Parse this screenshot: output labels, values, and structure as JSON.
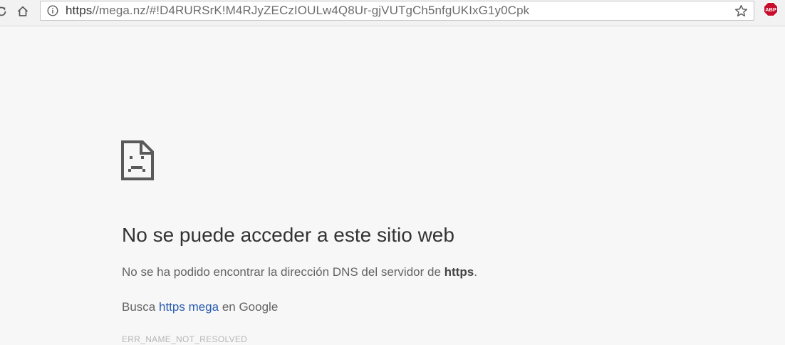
{
  "browser": {
    "address_bar": {
      "url_scheme": "https",
      "url_rest": "//mega.nz/#!D4RURSrK!M4RJyZECzIOULw4Q8Ur-gjVUTgCh5nfgUKIxG1y0Cpk"
    },
    "extension_label": "ABP",
    "icons": {
      "reload": "reload-icon",
      "home": "home-icon",
      "info": "info-icon",
      "bookmark": "star-icon",
      "extension": "adblock-plus-icon"
    },
    "colors": {
      "abp_red": "#c70d2c",
      "link_blue": "#2a5db0"
    }
  },
  "error_page": {
    "title": "No se puede acceder a este sitio web",
    "description_prefix": "No se ha podido encontrar la dirección DNS del servidor de ",
    "description_host": "https",
    "description_suffix": ".",
    "suggestion_prefix": "Busca ",
    "suggestion_link": "https mega",
    "suggestion_suffix": " en Google",
    "error_code": "ERR_NAME_NOT_RESOLVED"
  }
}
